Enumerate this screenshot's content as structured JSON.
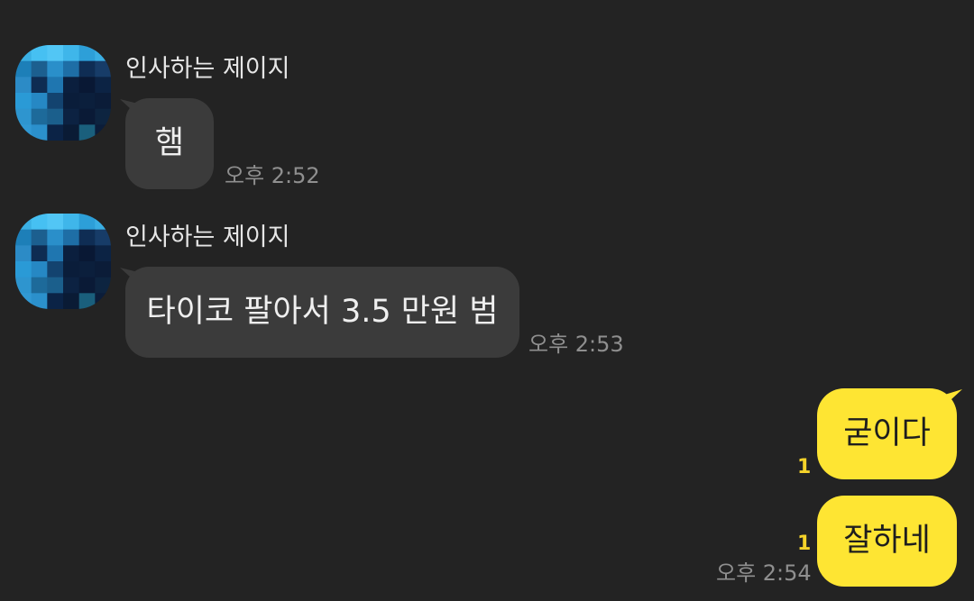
{
  "colors": {
    "background": "#232323",
    "incoming_bubble": "#3b3b3b",
    "outgoing_bubble": "#fee533",
    "unread_count": "#f5d32a"
  },
  "messages": [
    {
      "sender": "인사하는 제이지",
      "text": "햄",
      "time": "오후 2:52",
      "direction": "incoming"
    },
    {
      "sender": "인사하는 제이지",
      "text": "타이코 팔아서 3.5 만원 범",
      "time": "오후 2:53",
      "direction": "incoming"
    },
    {
      "text": "굳이다",
      "unread": "1",
      "direction": "outgoing"
    },
    {
      "text": "잘하네",
      "unread": "1",
      "time": "오후 2:54",
      "direction": "outgoing"
    }
  ],
  "avatar_icon": "pixelated-profile-photo"
}
